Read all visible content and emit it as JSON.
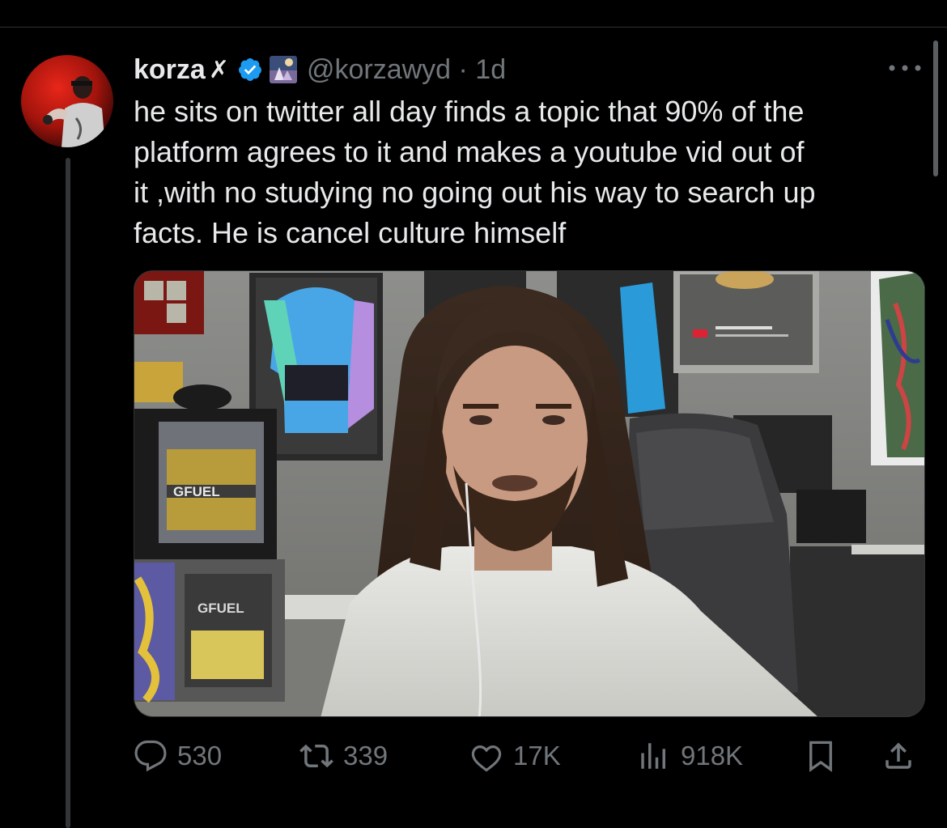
{
  "tweet": {
    "author_name": "korza",
    "author_name_symbol": "✗",
    "verified_icon": "verified-badge-icon",
    "handle": "@korzawyd · 1d",
    "text_lines": [
      "he sits on twitter all day finds a topic that 90% of the",
      "platform agrees to it and makes a youtube vid out of",
      "it ,with no studying no going out his way to search up",
      "facts. He is cancel culture himself"
    ],
    "media_overlay": {
      "can_label_1": "GFUEL",
      "can_label_2": "GFUEL"
    }
  },
  "actions": {
    "replies": "530",
    "reposts": "339",
    "likes": "17K",
    "views": "918K"
  },
  "colors": {
    "background": "#000000",
    "text": "#e7e9ea",
    "muted": "#71767b",
    "verified": "#1d9bf0",
    "divider": "#2f3336"
  }
}
